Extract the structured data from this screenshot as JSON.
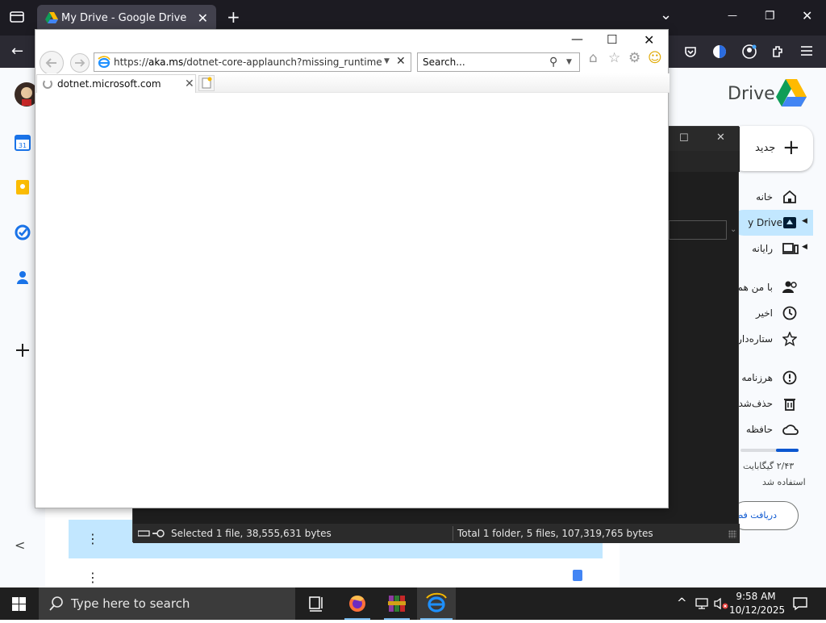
{
  "firefox": {
    "tab_title": "My Drive - Google Drive",
    "tab_close": "✕",
    "new_tab": "+",
    "list_all_tabs": "⌄",
    "minimize": "—",
    "restore": "❐",
    "close": "✕",
    "back": "←"
  },
  "drive": {
    "brand": "Drive",
    "new_label": "جدید",
    "new_plus": "+",
    "nav": [
      {
        "label": "خانه"
      },
      {
        "label": "y Drive"
      },
      {
        "label": "رایانه"
      },
      {
        "label": "با من هم"
      },
      {
        "label": "اخیر"
      },
      {
        "label": "ستاره‌دار"
      },
      {
        "label": "هرزنامه"
      },
      {
        "label": "حذف‌شده"
      },
      {
        "label": "حافظه"
      }
    ],
    "storage_used": "۲/۴۳ گیگابایت",
    "storage_used_suffix": "استفاده شد",
    "get_storage": "دریافت فضا",
    "row_menu": "⋮",
    "collapse": "<"
  },
  "winrar": {
    "maximize": "☐",
    "close": "✕",
    "status_left": "Selected 1 file, 38,555,631 bytes",
    "status_right": "Total 1 folder, 5 files, 107,319,765 bytes"
  },
  "ie": {
    "minimize": "—",
    "maximize": "☐",
    "close": "✕",
    "back": "⇦",
    "forward": "⇨",
    "url_prefix": "https://",
    "url_host": "aka.ms",
    "url_path": "/dotnet-core-applaunch?missing_runtime=true&",
    "url_dropdown": "▼",
    "url_stop": "✕",
    "search_placeholder": "Search...",
    "search_icon": "⚲",
    "search_dropdown": "▼",
    "home": "⌂",
    "favorites": "☆",
    "tools": "⚙",
    "smiley": "☺",
    "tab_title": "dotnet.microsoft.com",
    "tab_close": "✕"
  },
  "taskbar": {
    "search_placeholder": "Type here to search",
    "time": "9:58 AM",
    "date": "10/12/2025",
    "chevron": "^"
  },
  "colors": {
    "drive_active": "#c2e7ff",
    "drive_blue": "#0b57d0",
    "ie_blue": "#1e90ff",
    "taskbar_accent": "#76b9ed"
  }
}
